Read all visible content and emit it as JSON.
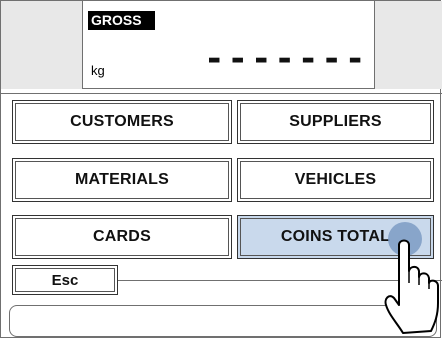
{
  "display": {
    "label": "GROSS",
    "unit": "kg",
    "reading": "-------"
  },
  "buttons": {
    "customers": "CUSTOMERS",
    "suppliers": "SUPPLIERS",
    "materials": "MATERIALS",
    "vehicles": "VEHICLES",
    "cards": "CARDS",
    "coins_total": "COINS TOTAL",
    "esc": "Esc"
  },
  "colors": {
    "selected_button": "#c9d9ec",
    "touch_indicator": "#7c9bc4"
  },
  "icons": {
    "pointer": "pointing-hand-icon"
  }
}
